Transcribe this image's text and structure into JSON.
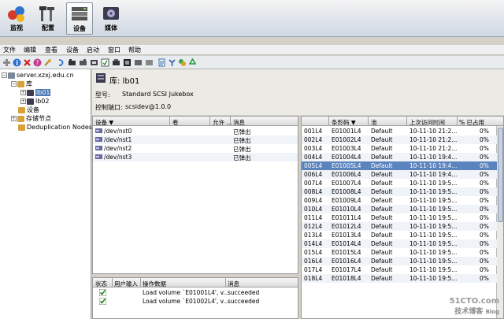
{
  "topnav": [
    {
      "label": "监视",
      "icon": "monitor-icon"
    },
    {
      "label": "配置",
      "icon": "configure-icon"
    },
    {
      "label": "设备",
      "icon": "device-icon",
      "selected": true
    },
    {
      "label": "媒体",
      "icon": "media-icon"
    }
  ],
  "menu": [
    "文件",
    "编辑",
    "查看",
    "设备",
    "启动",
    "窗口",
    "帮助"
  ],
  "tree": {
    "server": "server.xzxj.edu.cn",
    "library": "库",
    "lb01": "lb01",
    "lb02": "lb02",
    "devices": "设备",
    "storage": "存储节点",
    "dedup": "Deduplication Nodes"
  },
  "panel": {
    "title": "库: lb01",
    "model_label": "型号:",
    "model_value": "Standard SCSI Jukebox",
    "port_label": "控制端口:",
    "port_value": "scsidev@1.0.0"
  },
  "drives": {
    "columns": [
      "设备 ▼",
      "卷",
      "允许 ...",
      "消息"
    ],
    "rows": [
      [
        "/dev/nst0",
        "",
        "",
        "已弹出"
      ],
      [
        "/dev/nst1",
        "",
        "",
        "已弹出"
      ],
      [
        "/dev/nst2",
        "",
        "",
        "已弹出"
      ],
      [
        "/dev/nst3",
        "",
        "",
        "已弹出"
      ]
    ]
  },
  "status": {
    "columns": [
      "状态",
      "用户输入",
      "操作数据",
      "消息"
    ],
    "rows": [
      {
        "op": "Load volume `E01001L4', v...",
        "msg": "succeeded"
      },
      {
        "op": "Load volume `E01002L4', v...",
        "msg": "succeeded"
      }
    ]
  },
  "slots": {
    "columns": [
      "",
      "条形码 ▼",
      "池",
      "上次访问时间",
      "% 已占用"
    ],
    "rows": [
      [
        "001L4",
        "E01001L4",
        "Default",
        "10-11-10 21:2...",
        "0%"
      ],
      [
        "002L4",
        "E01002L4",
        "Default",
        "10-11-10 21:2...",
        "0%"
      ],
      [
        "003L4",
        "E01003L4",
        "Default",
        "10-11-10 21:2...",
        "0%"
      ],
      [
        "004L4",
        "E01004L4",
        "Default",
        "10-11-10 19:4...",
        "0%"
      ],
      [
        "005L4",
        "E01005L4",
        "Default",
        "10-11-10 19:4...",
        "0%"
      ],
      [
        "006L4",
        "E01006L4",
        "Default",
        "10-11-10 19:4...",
        "0%"
      ],
      [
        "007L4",
        "E01007L4",
        "Default",
        "10-11-10 19:5...",
        "0%"
      ],
      [
        "008L4",
        "E01008L4",
        "Default",
        "10-11-10 19:5...",
        "0%"
      ],
      [
        "009L4",
        "E01009L4",
        "Default",
        "10-11-10 19:5...",
        "0%"
      ],
      [
        "010L4",
        "E01010L4",
        "Default",
        "10-11-10 19:5...",
        "0%"
      ],
      [
        "011L4",
        "E01011L4",
        "Default",
        "10-11-10 19:5...",
        "0%"
      ],
      [
        "012L4",
        "E01012L4",
        "Default",
        "10-11-10 19:5...",
        "0%"
      ],
      [
        "013L4",
        "E01013L4",
        "Default",
        "10-11-10 19:5...",
        "0%"
      ],
      [
        "014L4",
        "E01014L4",
        "Default",
        "10-11-10 19:5...",
        "0%"
      ],
      [
        "015L4",
        "E01015L4",
        "Default",
        "10-11-10 19:5...",
        "0%"
      ],
      [
        "016L4",
        "E01016L4",
        "Default",
        "10-11-10 19:5...",
        "0%"
      ],
      [
        "017L4",
        "E01017L4",
        "Default",
        "10-11-10 19:5...",
        "0%"
      ],
      [
        "018L4",
        "E01018L4",
        "Default",
        "10-11-10 19:5...",
        "0%"
      ]
    ]
  },
  "watermark": {
    "line1": "51CTO.com",
    "line2": "技术博客",
    "line3": "Blog"
  }
}
